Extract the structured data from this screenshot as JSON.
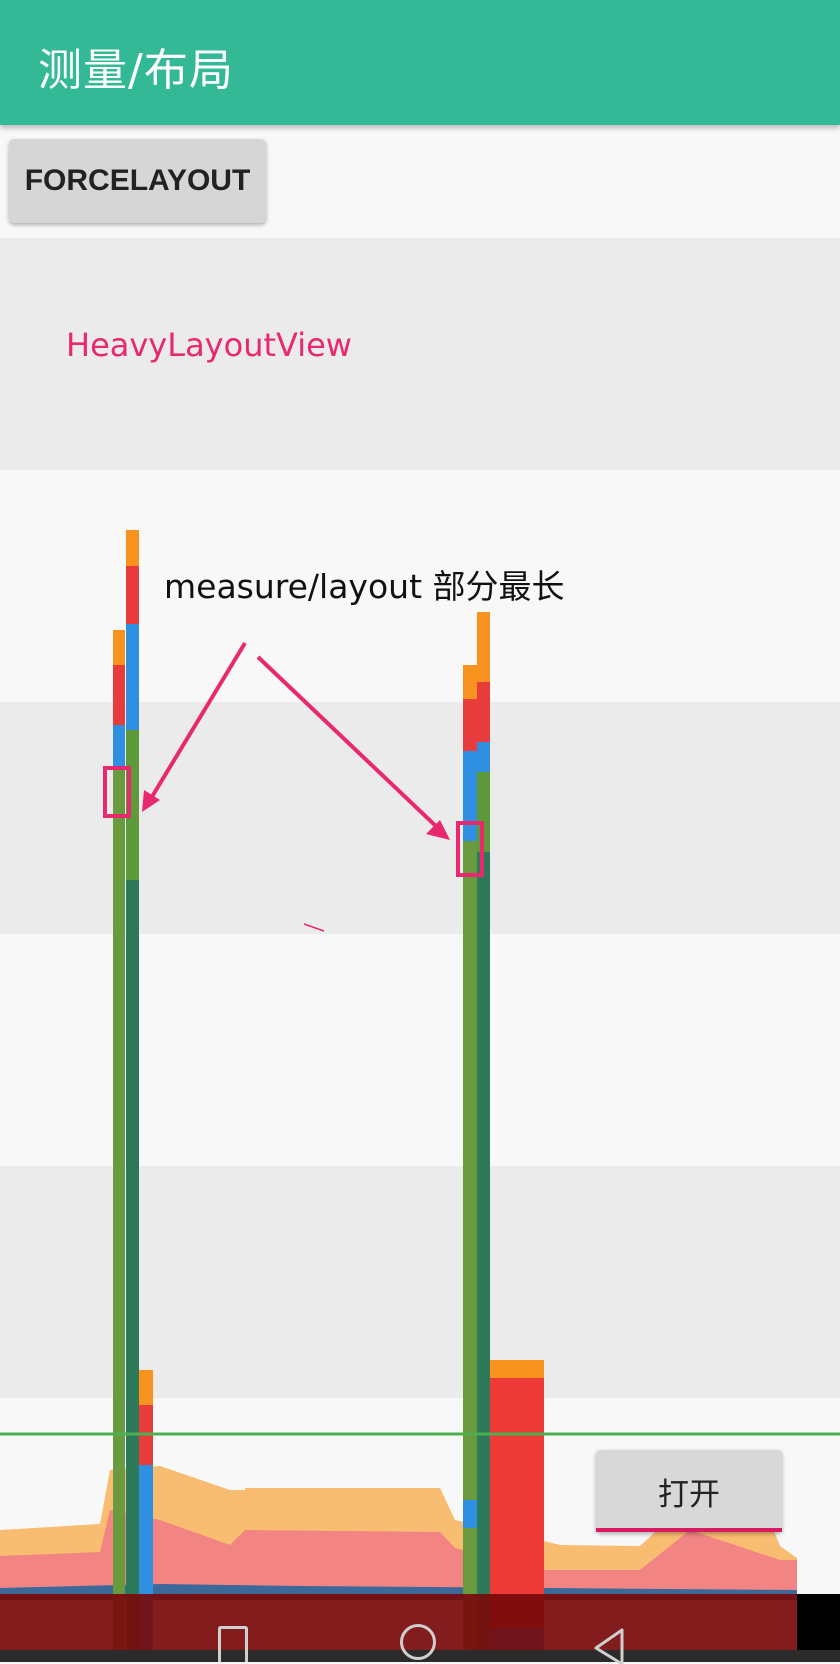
{
  "app_bar": {
    "title": "测量/布局"
  },
  "buttons": {
    "force_layout": "FORCELAYOUT",
    "open": "打开"
  },
  "heavy_view": {
    "label": "HeavyLayoutView"
  },
  "annotation": {
    "text": "measure/layout 部分最长"
  },
  "colors": {
    "app_bar": "#33b996",
    "measure_layout": "#689f38",
    "draw": "#2196f3",
    "sync_upload": "#ef3a3a",
    "command_issue": "#f7931e",
    "highlight_box": "#e8286f",
    "threshold_line": "#4caf50"
  },
  "nav_icons": [
    "recents-icon",
    "home-icon",
    "back-icon"
  ]
}
